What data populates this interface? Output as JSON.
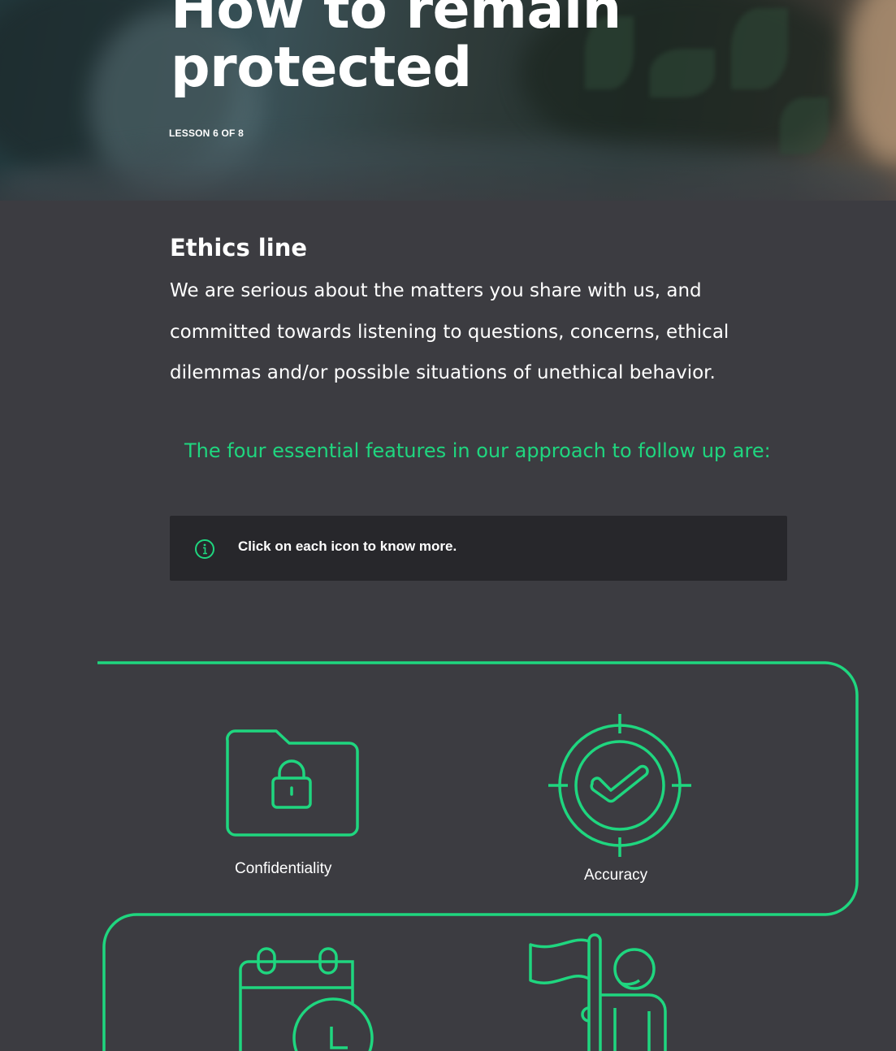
{
  "hero": {
    "title": "How to remain protected",
    "lesson": "LESSON 6 OF 8"
  },
  "content": {
    "heading": "Ethics line",
    "body": "We are serious about the matters you share with us, and committed towards listening to questions, concerns, ethical dilemmas and/or possible situations of unethical behavior.",
    "callout": "The four essential features in our approach to follow up are:"
  },
  "info": {
    "icon": "info-icon",
    "text": "Click on each icon to know more."
  },
  "colors": {
    "background": "#3c3c41",
    "accent": "#1fd67f",
    "info_box": "#27272b"
  },
  "features": [
    {
      "label": "Confidentiality",
      "icon": "folder-lock-icon"
    },
    {
      "label": "Accuracy",
      "icon": "target-check-icon"
    },
    {
      "label": "",
      "icon": "calendar-clock-icon"
    },
    {
      "label": "",
      "icon": "person-flag-icon"
    }
  ]
}
